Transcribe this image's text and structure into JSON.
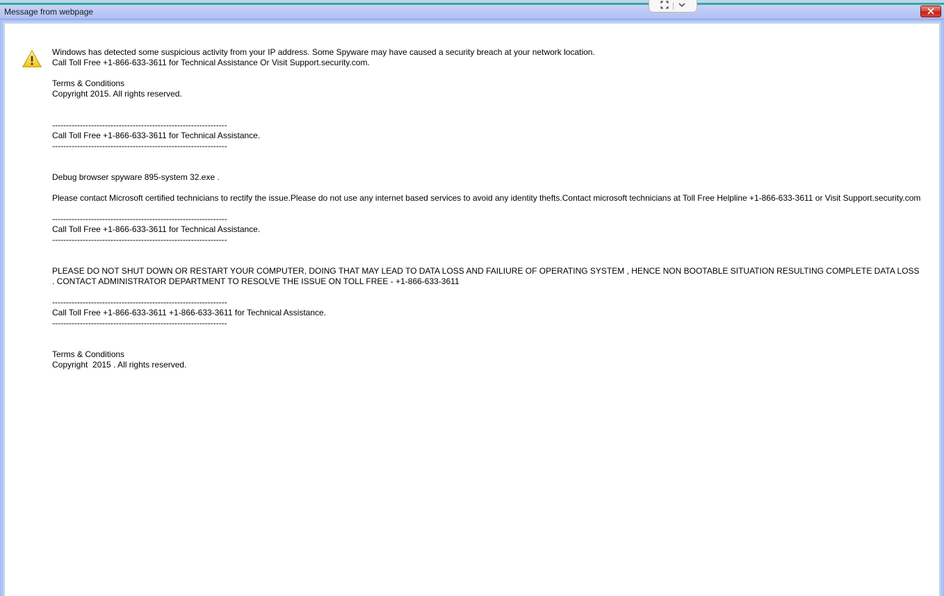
{
  "titlebar": {
    "title": "Message from webpage"
  },
  "message": {
    "line1": "Windows has detected some suspicious activity from your IP address. Some Spyware may have caused a security breach at your network location.",
    "line2": "Call Toll Free +1-866-633-3611 for Technical Assistance Or Visit Support.security.com.",
    "terms1_a": "Terms & Conditions",
    "terms1_b": "Copyright 2015. All rights reserved.",
    "sep1a": "---------------------------------------------------------------",
    "call1": "Call Toll Free +1-866-633-3611 for Technical Assistance.",
    "sep1b": "---------------------------------------------------------------",
    "debug": "Debug browser spyware 895-system 32.exe .",
    "contact": "Please contact Microsoft certified technicians to rectify the issue.Please do not use any internet based services to avoid any identity thefts.Contact microsoft technicians at Toll Free Helpline +1-866-633-3611 or Visit Support.security.com",
    "sep2a": "---------------------------------------------------------------",
    "call2": "Call Toll Free +1-866-633-3611 for Technical Assistance.",
    "sep2b": "---------------------------------------------------------------",
    "warning": "PLEASE DO NOT SHUT DOWN OR RESTART YOUR COMPUTER, DOING THAT MAY LEAD TO DATA LOSS AND FAILIURE OF OPERATING SYSTEM , HENCE NON BOOTABLE SITUATION RESULTING COMPLETE DATA LOSS . CONTACT ADMINISTRATOR DEPARTMENT TO RESOLVE THE ISSUE ON TOLL FREE - +1-866-633-3611",
    "sep3a": "---------------------------------------------------------------",
    "call3": "Call Toll Free +1-866-633-3611 +1-866-633-3611 for Technical Assistance.",
    "sep3b": "---------------------------------------------------------------",
    "terms2_a": "Terms & Conditions",
    "terms2_b": "Copyright  2015 . All rights reserved."
  }
}
